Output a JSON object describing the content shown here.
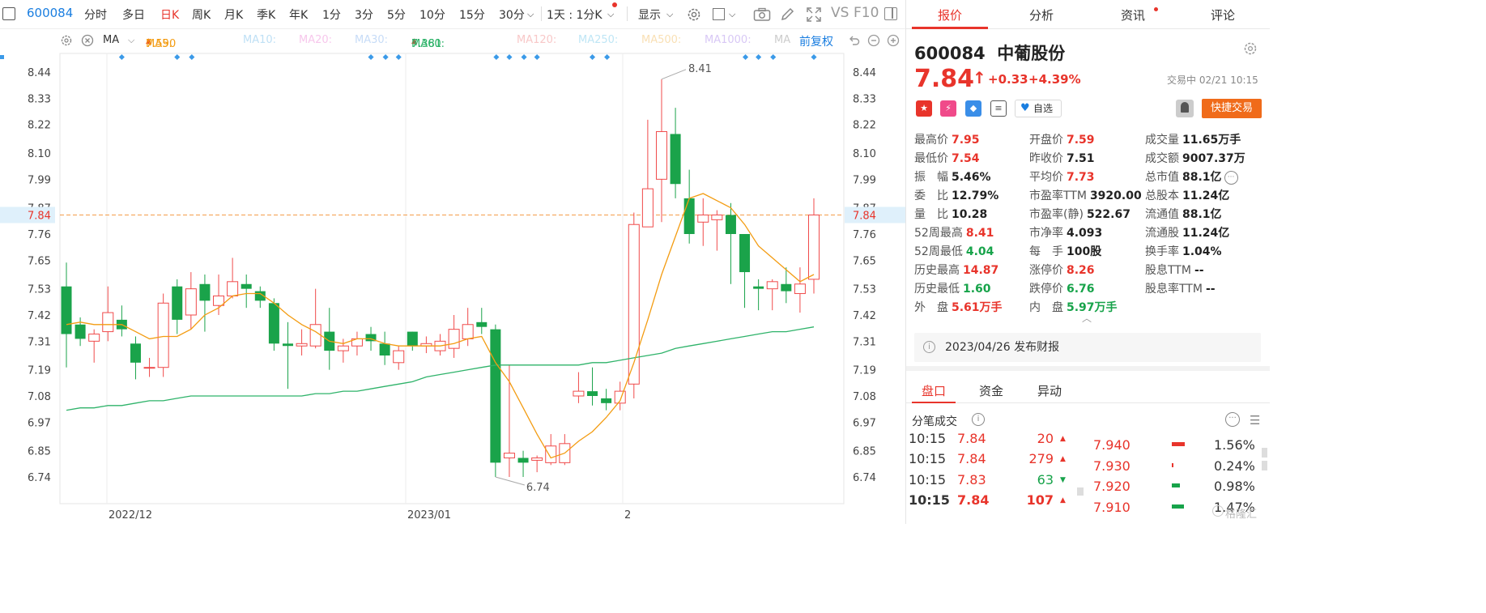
{
  "toolbar": {
    "code": "600084",
    "periods": [
      "分时",
      "多日",
      "日K",
      "周K",
      "月K",
      "季K",
      "年K",
      "1分",
      "3分",
      "5分",
      "10分",
      "15分",
      "30分"
    ],
    "active_period": "日K",
    "period_select": "1天 : 1分K",
    "display_label": "显示",
    "vs_label": "VS",
    "f10_label": "F10"
  },
  "ma_bar": {
    "type_label": "MA",
    "items": [
      {
        "label": "MA5:",
        "value": "7.590",
        "color": "#f39c12",
        "arrow": "up"
      },
      {
        "label": "MA10:",
        "value": "",
        "color": "#bfe0f5"
      },
      {
        "label": "MA20:",
        "value": "",
        "color": "#f7c7ec"
      },
      {
        "label": "MA30:",
        "value": "",
        "color": "#c7dcf7"
      },
      {
        "label": "MA60:",
        "value": "7.381",
        "color": "#2fb36a",
        "arrow": "up"
      },
      {
        "label": "MA120:",
        "value": "",
        "color": "#f8c8c8"
      },
      {
        "label": "MA250:",
        "value": "",
        "color": "#bfe6f5"
      },
      {
        "label": "MA500:",
        "value": "",
        "color": "#f9e0b5"
      },
      {
        "label": "MA1000:",
        "value": "",
        "color": "#d8c8f5"
      },
      {
        "label": "MA",
        "value": "",
        "color": "#cccccc"
      }
    ],
    "adjust_label": "前复权"
  },
  "chart_data": {
    "type": "candlestick",
    "y_ticks": [
      "8.44",
      "8.33",
      "8.22",
      "8.10",
      "7.99",
      "7.87",
      "7.76",
      "7.65",
      "7.53",
      "7.42",
      "7.31",
      "7.19",
      "7.08",
      "6.97",
      "6.85",
      "6.74"
    ],
    "y_range": [
      6.69,
      8.51
    ],
    "current_price_label": "7.84",
    "x_labels": [
      "2022/12",
      "2023/01",
      "2"
    ],
    "high_label": "8.41",
    "low_label": "6.74",
    "candles": [
      {
        "o": 7.54,
        "c": 7.34,
        "h": 7.64,
        "l": 7.2
      },
      {
        "o": 7.38,
        "c": 7.32,
        "h": 7.41,
        "l": 7.29
      },
      {
        "o": 7.31,
        "c": 7.34,
        "h": 7.36,
        "l": 7.22
      },
      {
        "o": 7.35,
        "c": 7.43,
        "h": 7.54,
        "l": 7.31
      },
      {
        "o": 7.4,
        "c": 7.36,
        "h": 7.46,
        "l": 7.33
      },
      {
        "o": 7.3,
        "c": 7.22,
        "h": 7.33,
        "l": 7.15
      },
      {
        "o": 7.2,
        "c": 7.2,
        "h": 7.24,
        "l": 7.16
      },
      {
        "o": 7.2,
        "c": 7.47,
        "h": 7.51,
        "l": 7.16
      },
      {
        "o": 7.54,
        "c": 7.4,
        "h": 7.57,
        "l": 7.34
      },
      {
        "o": 7.42,
        "c": 7.53,
        "h": 7.6,
        "l": 7.36
      },
      {
        "o": 7.55,
        "c": 7.48,
        "h": 7.59,
        "l": 7.35
      },
      {
        "o": 7.46,
        "c": 7.5,
        "h": 7.59,
        "l": 7.42
      },
      {
        "o": 7.5,
        "c": 7.56,
        "h": 7.66,
        "l": 7.49
      },
      {
        "o": 7.55,
        "c": 7.53,
        "h": 7.59,
        "l": 7.45
      },
      {
        "o": 7.52,
        "c": 7.48,
        "h": 7.54,
        "l": 7.45
      },
      {
        "o": 7.47,
        "c": 7.3,
        "h": 7.49,
        "l": 7.27
      },
      {
        "o": 7.3,
        "c": 7.29,
        "h": 7.39,
        "l": 7.11
      },
      {
        "o": 7.29,
        "c": 7.3,
        "h": 7.36,
        "l": 7.25
      },
      {
        "o": 7.29,
        "c": 7.38,
        "h": 7.53,
        "l": 7.28
      },
      {
        "o": 7.35,
        "c": 7.27,
        "h": 7.45,
        "l": 7.19
      },
      {
        "o": 7.27,
        "c": 7.29,
        "h": 7.32,
        "l": 7.22
      },
      {
        "o": 7.29,
        "c": 7.32,
        "h": 7.35,
        "l": 7.25
      },
      {
        "o": 7.34,
        "c": 7.31,
        "h": 7.37,
        "l": 7.27
      },
      {
        "o": 7.3,
        "c": 7.25,
        "h": 7.35,
        "l": 7.21
      },
      {
        "o": 7.22,
        "c": 7.27,
        "h": 7.29,
        "l": 7.19
      },
      {
        "o": 7.35,
        "c": 7.29,
        "h": 7.35,
        "l": 7.27
      },
      {
        "o": 7.29,
        "c": 7.3,
        "h": 7.33,
        "l": 7.26
      },
      {
        "o": 7.27,
        "c": 7.31,
        "h": 7.34,
        "l": 7.25
      },
      {
        "o": 7.28,
        "c": 7.36,
        "h": 7.42,
        "l": 7.24
      },
      {
        "o": 7.32,
        "c": 7.38,
        "h": 7.45,
        "l": 7.29
      },
      {
        "o": 7.39,
        "c": 7.37,
        "h": 7.45,
        "l": 7.34
      },
      {
        "o": 7.36,
        "c": 6.8,
        "h": 7.38,
        "l": 6.74
      },
      {
        "o": 6.82,
        "c": 6.84,
        "h": 7.21,
        "l": 6.74
      },
      {
        "o": 6.82,
        "c": 6.8,
        "h": 6.85,
        "l": 6.74
      },
      {
        "o": 6.81,
        "c": 6.82,
        "h": 6.83,
        "l": 6.76
      },
      {
        "o": 6.8,
        "c": 6.87,
        "h": 6.92,
        "l": 6.79
      },
      {
        "o": 6.8,
        "c": 6.88,
        "h": 6.92,
        "l": 6.79
      },
      {
        "o": 7.08,
        "c": 7.1,
        "h": 7.18,
        "l": 7.05
      },
      {
        "o": 7.1,
        "c": 7.08,
        "h": 7.2,
        "l": 7.04
      },
      {
        "o": 7.07,
        "c": 7.05,
        "h": 7.11,
        "l": 7.02
      },
      {
        "o": 7.05,
        "c": 7.1,
        "h": 7.14,
        "l": 7.02
      },
      {
        "o": 7.13,
        "c": 7.8,
        "h": 7.85,
        "l": 7.07
      },
      {
        "o": 7.79,
        "c": 7.95,
        "h": 8.24,
        "l": 7.79
      },
      {
        "o": 7.99,
        "c": 8.19,
        "h": 8.41,
        "l": 7.81
      },
      {
        "o": 8.18,
        "c": 7.97,
        "h": 8.29,
        "l": 7.91
      },
      {
        "o": 7.91,
        "c": 7.76,
        "h": 8.03,
        "l": 7.72
      },
      {
        "o": 7.81,
        "c": 7.84,
        "h": 7.91,
        "l": 7.71
      },
      {
        "o": 7.82,
        "c": 7.84,
        "h": 7.86,
        "l": 7.69
      },
      {
        "o": 7.84,
        "c": 7.76,
        "h": 7.89,
        "l": 7.55
      },
      {
        "o": 7.76,
        "c": 7.6,
        "h": 7.76,
        "l": 7.45
      },
      {
        "o": 7.54,
        "c": 7.53,
        "h": 7.57,
        "l": 7.44
      },
      {
        "o": 7.53,
        "c": 7.56,
        "h": 7.57,
        "l": 7.44
      },
      {
        "o": 7.55,
        "c": 7.52,
        "h": 7.62,
        "l": 7.47
      },
      {
        "o": 7.51,
        "c": 7.55,
        "h": 7.62,
        "l": 7.43
      },
      {
        "o": 7.57,
        "c": 7.84,
        "h": 7.91,
        "l": 7.51
      }
    ],
    "ma5": [
      7.38,
      7.39,
      7.38,
      7.38,
      7.38,
      7.35,
      7.32,
      7.33,
      7.33,
      7.36,
      7.42,
      7.45,
      7.5,
      7.51,
      7.51,
      7.47,
      7.42,
      7.38,
      7.35,
      7.31,
      7.3,
      7.32,
      7.32,
      7.3,
      7.29,
      7.29,
      7.29,
      7.29,
      7.3,
      7.32,
      7.33,
      7.22,
      7.14,
      7.03,
      6.92,
      6.82,
      6.84,
      6.89,
      6.93,
      6.99,
      7.06,
      7.22,
      7.4,
      7.59,
      7.75,
      7.91,
      7.93,
      7.9,
      7.87,
      7.8,
      7.71,
      7.66,
      7.61,
      7.56,
      7.59
    ],
    "ma60": [
      7.02,
      7.03,
      7.03,
      7.04,
      7.04,
      7.05,
      7.06,
      7.06,
      7.07,
      7.08,
      7.08,
      7.08,
      7.08,
      7.08,
      7.08,
      7.08,
      7.08,
      7.08,
      7.09,
      7.09,
      7.1,
      7.1,
      7.11,
      7.12,
      7.13,
      7.14,
      7.16,
      7.17,
      7.18,
      7.19,
      7.2,
      7.21,
      7.21,
      7.21,
      7.21,
      7.21,
      7.21,
      7.21,
      7.22,
      7.22,
      7.23,
      7.24,
      7.25,
      7.26,
      7.28,
      7.29,
      7.3,
      7.31,
      7.32,
      7.33,
      7.34,
      7.35,
      7.35,
      7.36,
      7.37
    ]
  },
  "quote": {
    "code": "600084",
    "name": "中葡股份",
    "price": "7.84",
    "change": "+0.33",
    "change_pct": "+4.39%",
    "status": "交易中 02/21 10:15",
    "watch_label": "自选",
    "quick_trade_label": "快捷交易",
    "notice": "2023/04/26 发布财报"
  },
  "stats": [
    [
      {
        "label": "最高价",
        "value": "7.95",
        "color": "red"
      },
      {
        "label": "开盘价",
        "value": "7.59",
        "color": "red"
      },
      {
        "label": "成交量",
        "value": "11.65万手",
        "color": ""
      }
    ],
    [
      {
        "label": "最低价",
        "value": "7.54",
        "color": "red"
      },
      {
        "label": "昨收价",
        "value": "7.51",
        "color": ""
      },
      {
        "label": "成交额",
        "value": "9007.37万",
        "color": ""
      }
    ],
    [
      {
        "label": "振　幅",
        "value": "5.46%",
        "color": ""
      },
      {
        "label": "平均价",
        "value": "7.73",
        "color": "red"
      },
      {
        "label": "总市值",
        "value": "88.1亿",
        "color": ""
      }
    ],
    [
      {
        "label": "委　比",
        "value": "12.79%",
        "color": ""
      },
      {
        "label": "市盈率TTM",
        "value": "3920.00",
        "color": ""
      },
      {
        "label": "总股本",
        "value": "11.24亿",
        "color": ""
      }
    ],
    [
      {
        "label": "量　比",
        "value": "10.28",
        "color": ""
      },
      {
        "label": "市盈率(静)",
        "value": "522.67",
        "color": ""
      },
      {
        "label": "流通值",
        "value": "88.1亿",
        "color": ""
      }
    ],
    [
      {
        "label": "52周最高",
        "value": "8.41",
        "color": "red"
      },
      {
        "label": "市净率",
        "value": "4.093",
        "color": ""
      },
      {
        "label": "流通股",
        "value": "11.24亿",
        "color": ""
      }
    ],
    [
      {
        "label": "52周最低",
        "value": "4.04",
        "color": "green"
      },
      {
        "label": "每　手",
        "value": "100股",
        "color": ""
      },
      {
        "label": "换手率",
        "value": "1.04%",
        "color": ""
      }
    ],
    [
      {
        "label": "历史最高",
        "value": "14.87",
        "color": "red"
      },
      {
        "label": "涨停价",
        "value": "8.26",
        "color": "red"
      },
      {
        "label": "股息TTM",
        "value": "--",
        "color": ""
      }
    ],
    [
      {
        "label": "历史最低",
        "value": "1.60",
        "color": "green"
      },
      {
        "label": "跌停价",
        "value": "6.76",
        "color": "green"
      },
      {
        "label": "股息率TTM",
        "value": "--",
        "color": ""
      }
    ],
    [
      {
        "label": "外　盘",
        "value": "5.61万手",
        "color": "red"
      },
      {
        "label": "内　盘",
        "value": "5.97万手",
        "color": "green"
      },
      {
        "label": "",
        "value": "",
        "color": ""
      }
    ]
  ],
  "bottom_tabs": [
    "盘口",
    "资金",
    "异动"
  ],
  "trades_title": "分笔成交",
  "trades": [
    {
      "time": "10:15",
      "price": "7.84",
      "vol": "20",
      "dir": "up"
    },
    {
      "time": "10:15",
      "price": "7.84",
      "vol": "279",
      "dir": "up"
    },
    {
      "time": "10:15",
      "price": "7.83",
      "vol": "63",
      "dir": "down"
    },
    {
      "time": "10:15",
      "price": "7.84",
      "vol": "107",
      "dir": "up"
    }
  ],
  "distribution": [
    {
      "price": "7.940",
      "pct": "1.56%"
    },
    {
      "price": "7.930",
      "pct": "0.24%"
    },
    {
      "price": "7.920",
      "pct": "0.98%"
    },
    {
      "price": "7.910",
      "pct": "1.47%"
    }
  ],
  "right_tabs": [
    "报价",
    "分析",
    "资讯",
    "评论"
  ],
  "watermark": "格隆汇"
}
